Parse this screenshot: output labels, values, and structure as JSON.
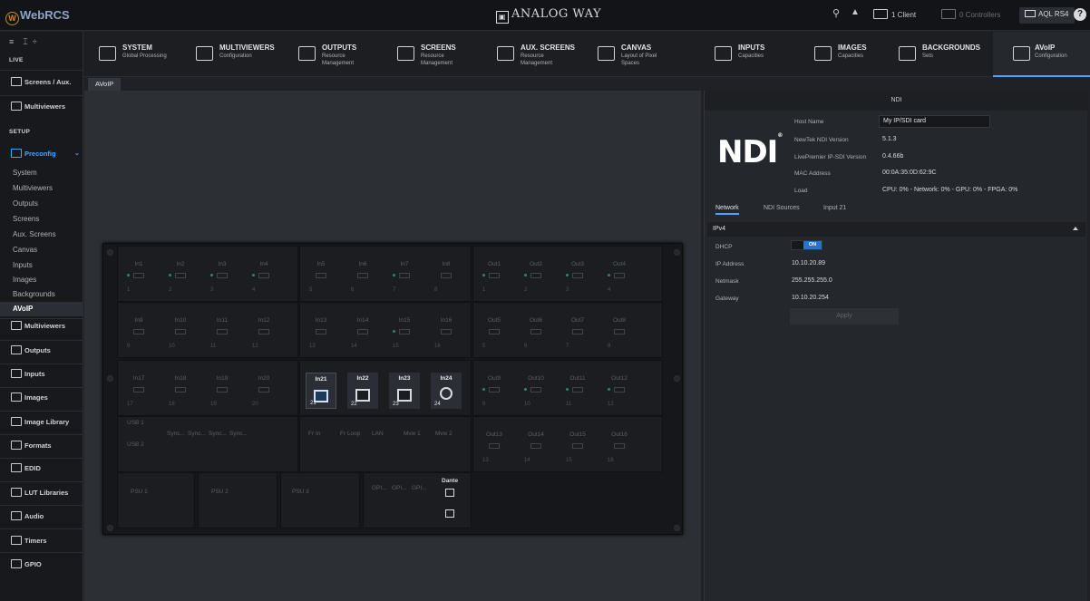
{
  "topbar": {
    "app_name": "WebRCS",
    "brand": "ANALOG WAY",
    "clients": "1 Client",
    "controllers": "0 Controllers",
    "device": "AQL RS4",
    "help": "?"
  },
  "sidebar": {
    "mode": "LIVE",
    "items_live": [
      "Screens / Aux.",
      "Multiviewers"
    ],
    "setup_label": "SETUP",
    "preconfig": "Preconfig",
    "preconfig_sub": [
      "System",
      "Multiviewers",
      "Outputs",
      "Screens",
      "Aux. Screens",
      "Canvas",
      "Inputs",
      "Images",
      "Backgrounds",
      "AVoIP"
    ],
    "items_setup": [
      "Multiviewers",
      "Outputs",
      "Inputs",
      "Images",
      "Image Library",
      "Formats",
      "EDID",
      "LUT Libraries",
      "Audio",
      "Timers",
      "GPIO"
    ]
  },
  "nav": [
    {
      "title": "SYSTEM",
      "sub": "Global Processing"
    },
    {
      "title": "MULTIVIEWERS",
      "sub": "Configuration"
    },
    {
      "title": "OUTPUTS",
      "sub": "Resource Management"
    },
    {
      "title": "SCREENS",
      "sub": "Resource Management"
    },
    {
      "title": "AUX. SCREENS",
      "sub": "Resource Management"
    },
    {
      "title": "CANVAS",
      "sub": "Layout of Pixel Spaces"
    },
    {
      "title": "INPUTS",
      "sub": "Capacities"
    },
    {
      "title": "IMAGES",
      "sub": "Capacities"
    },
    {
      "title": "BACKGROUNDS",
      "sub": "Sets"
    },
    {
      "title": "AVoIP",
      "sub": "Configuration"
    }
  ],
  "tab": "AVoIP",
  "device": {
    "inputs": [
      "In1",
      "In2",
      "In3",
      "In4",
      "In5",
      "In6",
      "In7",
      "In8",
      "In9",
      "In10",
      "In11",
      "In12",
      "In13",
      "In14",
      "In15",
      "In16",
      "In17",
      "In18",
      "In19",
      "In20",
      "In21",
      "In22",
      "In23",
      "In24"
    ],
    "outputs": [
      "Out1",
      "Out2",
      "Out3",
      "Out4",
      "Out5",
      "Out6",
      "Out7",
      "Out8",
      "Out9",
      "Out10",
      "Out11",
      "Out12",
      "Out13",
      "Out14",
      "Out15",
      "Out16"
    ],
    "usb": [
      "USB 1",
      "USB 2"
    ],
    "sync": [
      "Sync...",
      "Sync...",
      "Sync...",
      "Sync..."
    ],
    "misc": [
      "Fr In",
      "Fr Loop",
      "LAN",
      "Mvw 1",
      "Mvw 2"
    ],
    "psu": [
      "PSU 1",
      "PSU 2",
      "PSU 3"
    ],
    "gpi": [
      "GPI...",
      "GPI...",
      "GPI..."
    ],
    "dante": "Dante"
  },
  "ndi": {
    "title": "NDI",
    "logo": "NDI",
    "host_name_label": "Host Name",
    "host_name": "My IP/SDI card",
    "ndi_version_label": "NewTek NDI Version",
    "ndi_version": "5.1.3",
    "ipsdi_version_label": "LivePremier IP-SDI Version",
    "ipsdi_version": "0.4.66b",
    "mac_label": "MAC Address",
    "mac": "00:0A:35:0D:62:9C",
    "load_label": "Load",
    "load": "CPU: 0% - Network: 0% - GPU: 0% - FPGA: 0%",
    "tabs": [
      "Network",
      "NDI Sources",
      "Input 21"
    ],
    "ipv4": "IPv4",
    "dhcp_label": "DHCP",
    "dhcp": "ON",
    "ip_label": "IP Address",
    "ip": "10.10.20.89",
    "netmask_label": "Netmask",
    "netmask": "255.255.255.0",
    "gateway_label": "Gateway",
    "gateway": "10.10.20.254",
    "apply": "Apply"
  }
}
